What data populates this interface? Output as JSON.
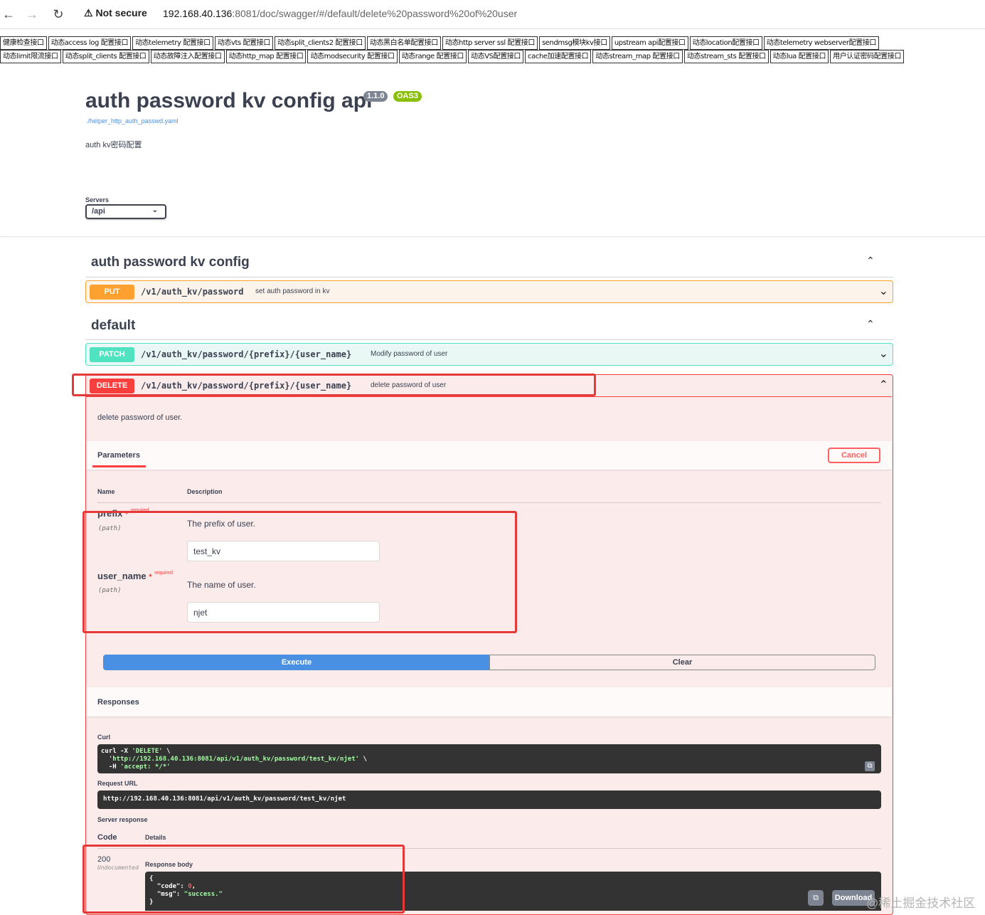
{
  "browser": {
    "security": "Not secure",
    "url_host": "192.168.40.136",
    "url_rest": ":8081/doc/swagger/#/default/delete%20password%20of%20user"
  },
  "links_row1": [
    "健康检查接口",
    "动态access log 配置接口",
    "动态telemetry 配置接口",
    "动态vts 配置接口",
    "动态split_clients2 配置接口",
    "动态黑白名单配置接口",
    "动态http server ssl 配置接口",
    "sendmsg模块kv接口",
    "upstream api配置接口",
    "动态location配置接口",
    "动态telemetry webserver配置接口"
  ],
  "links_row2": [
    "动态limit限流接口",
    "动态split_clients 配置接口",
    "动态故障注入配置接口",
    "动态http_map 配置接口",
    "动态modsecurity 配置接口",
    "动态range 配置接口",
    "动态VS配置接口",
    "cache加速配置接口",
    "动态stream_map 配置接口",
    "动态stream_sts 配置接口",
    "动态lua 配置接口",
    "用户认证密码配置接口"
  ],
  "info": {
    "title": "auth password kv config api",
    "version": "1.1.0",
    "oas": "OAS3",
    "spec_link": "./helper_http_auth_passwd.yaml",
    "description": "auth kv密码配置"
  },
  "servers": {
    "label": "Servers",
    "selected": "/api"
  },
  "tags": [
    {
      "name": "auth password kv config"
    },
    {
      "name": "default"
    }
  ],
  "ops": {
    "put": {
      "method": "PUT",
      "path": "/v1/auth_kv/password",
      "summary": "set auth password in kv"
    },
    "patch": {
      "method": "PATCH",
      "path": "/v1/auth_kv/password/{prefix}/{user_name}",
      "summary": "Modify password of user"
    },
    "delete": {
      "method": "DELETE",
      "path": "/v1/auth_kv/password/{prefix}/{user_name}",
      "summary": "delete password of user",
      "description": "delete password of user."
    }
  },
  "params": {
    "title": "Parameters",
    "cancel": "Cancel",
    "col_name": "Name",
    "col_desc": "Description",
    "required_text": "required",
    "items": [
      {
        "name": "prefix",
        "in": "(path)",
        "description": "The prefix of user.",
        "value": "test_kv"
      },
      {
        "name": "user_name",
        "in": "(path)",
        "description": "The name of user.",
        "value": "njet"
      }
    ]
  },
  "actions": {
    "execute": "Execute",
    "clear": "Clear"
  },
  "responses": {
    "title": "Responses",
    "curl_label": "Curl",
    "curl_line1_a": "curl -X ",
    "curl_line1_b": "'DELETE'",
    "curl_line1_c": " \\",
    "curl_line2_a": "  ",
    "curl_line2_b": "'http://192.168.40.136:8081/api/v1/auth_kv/password/test_kv/njet'",
    "curl_line2_c": " \\",
    "curl_line3_a": "  -H ",
    "curl_line3_b": "'accept: */*'",
    "request_url_label": "Request URL",
    "request_url": "http://192.168.40.136:8081/api/v1/auth_kv/password/test_kv/njet",
    "server_response_label": "Server response",
    "col_code": "Code",
    "col_details": "Details",
    "code": "200",
    "undocumented": "Undocumented",
    "body_label": "Response body",
    "body_open": "{",
    "body_code_key": "  \"code\": ",
    "body_code_val": "0",
    "body_msg_key": "  \"msg\": ",
    "body_msg_val": "\"success.\"",
    "body_close": "}",
    "download": "Download"
  },
  "watermark": "@稀土掘金技术社区",
  "colors": {
    "put": "#fca130",
    "patch": "#50e3c2",
    "delete": "#f93e3e",
    "execute": "#4990e2",
    "annotation": "#e5393a"
  }
}
